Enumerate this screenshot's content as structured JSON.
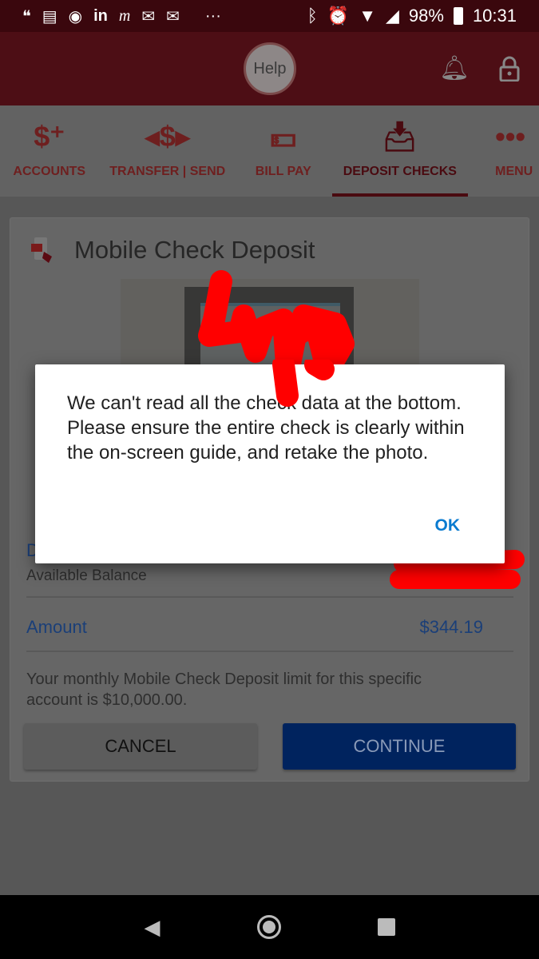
{
  "status_bar": {
    "battery": "98%",
    "time": "10:31",
    "more": "···",
    "notification_icons": [
      "hangouts-icon",
      "news-icon",
      "messenger-icon",
      "linkedin-icon",
      "m-icon",
      "gmail-icon",
      "gmail-icon"
    ]
  },
  "header": {
    "help_label": "Help"
  },
  "nav": {
    "items": [
      {
        "label": "ACCOUNTS",
        "icon": "dollar-plus-icon"
      },
      {
        "label": "TRANSFER | SEND",
        "icon": "transfer-icon"
      },
      {
        "label": "BILL PAY",
        "icon": "money-icon"
      },
      {
        "label": "DEPOSIT CHECKS",
        "icon": "deposit-icon",
        "active": true
      },
      {
        "label": "MENU",
        "icon": "more-icon"
      }
    ]
  },
  "card": {
    "title": "Mobile Check Deposit",
    "deposit_to_label": "D",
    "available_balance_label": "Available Balance",
    "amount_label": "Amount",
    "amount_value": "$344.19",
    "limit_text": "Your monthly Mobile Check Deposit limit for this specific account is $10,000.00.",
    "cancel_label": "CANCEL",
    "continue_label": "CONTINUE"
  },
  "dialog": {
    "message": "We can't read all the check data at the bottom. Please ensure the entire check is clearly within the on-screen guide, and retake the photo.",
    "ok_label": "OK"
  },
  "colors": {
    "brand_red": "#bf2233",
    "link_blue": "#0b55b5",
    "continue_blue": "#003a9e",
    "dialog_ok": "#0a7bd0",
    "scribble": "#ff0000"
  }
}
